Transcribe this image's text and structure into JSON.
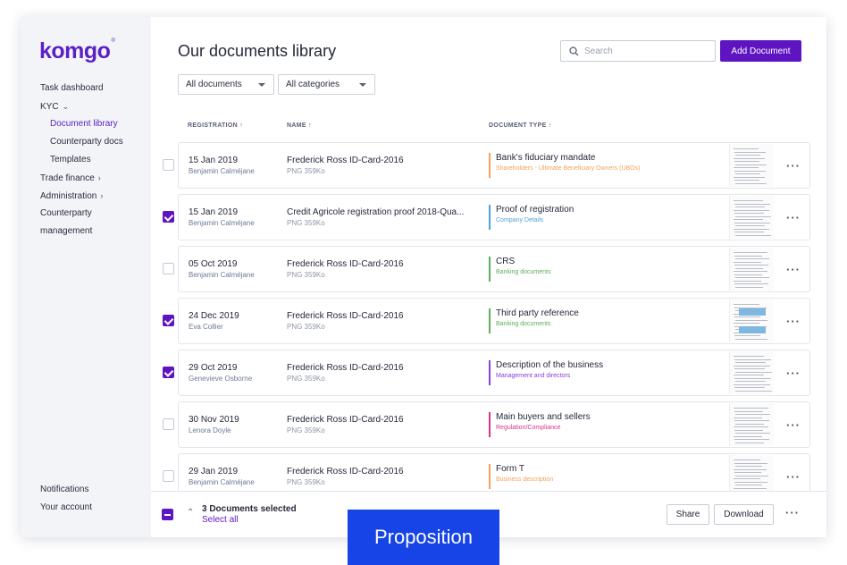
{
  "app": {
    "logo": "komgo",
    "logo_mark": "®"
  },
  "sidebar": {
    "items": [
      {
        "label": "Task dashboard"
      },
      {
        "label": "KYC",
        "chevron": "⌄"
      },
      {
        "label": "Document library",
        "active": true
      },
      {
        "label": "Counterparty docs"
      },
      {
        "label": "Templates"
      },
      {
        "label": "Trade finance",
        "chevron": "›"
      },
      {
        "label": "Administration",
        "chevron": "›"
      },
      {
        "label": "Counterparty"
      },
      {
        "label": "management"
      }
    ],
    "bottom": [
      {
        "label": "Notifications"
      },
      {
        "label": "Your account"
      }
    ]
  },
  "header": {
    "title": "Our documents library",
    "search_placeholder": "Search",
    "add_button": "Add Document"
  },
  "filters": {
    "documents": "All documents",
    "categories": "All categories"
  },
  "columns": {
    "registration": "REGISTRATION ↑",
    "name": "NAME ↑",
    "type": "DOCUMENT TYPE ↑"
  },
  "rows": [
    {
      "date": "15 Jan 2019",
      "person": "Benjamin Calméjane",
      "name": "Frederick Ross ID-Card-2016",
      "meta": "PNG   359Ko",
      "type": "Bank's fiduciary mandate",
      "category": "Shareholders - Ultimate Beneficiary Owners (UBOs)",
      "color": "#f2a35c",
      "checked": false
    },
    {
      "date": "15 Jan 2019",
      "person": "Benjamin Calméjane",
      "name": "Credit Agricole registration proof 2018-Qua...",
      "meta": "PNG   359Ko",
      "type": "Proof of registration",
      "category": "Company Details",
      "color": "#4fa3dc",
      "checked": true
    },
    {
      "date": "05 Oct 2019",
      "person": "Benjamin Calméjane",
      "name": "Frederick Ross ID-Card-2016",
      "meta": "PNG   359Ko",
      "type": "CRS",
      "category": "Banking documents",
      "color": "#5fae5a",
      "checked": false
    },
    {
      "date": "24 Dec 2019",
      "person": "Eva Collier",
      "name": "Frederick Ross ID-Card-2016",
      "meta": "PNG   359Ko",
      "type": "Third party reference",
      "category": "Banking documents",
      "color": "#5fae5a",
      "checked": true
    },
    {
      "date": "29 Oct 2019",
      "person": "Genevieve Osborne",
      "name": "Frederick Ross ID-Card-2016",
      "meta": "PNG   359Ko",
      "type": "Description of the business",
      "category": "Management and directors",
      "color": "#8a3fd8",
      "checked": true
    },
    {
      "date": "30 Nov 2019",
      "person": "Lenora Doyle",
      "name": "Frederick Ross ID-Card-2016",
      "meta": "PNG   359Ko",
      "type": "Main buyers and sellers",
      "category": "Regulation/Compliance",
      "color": "#d8338a",
      "checked": false
    },
    {
      "date": "29 Jan 2019",
      "person": "Benjamin Calméjane",
      "name": "Frederick Ross ID-Card-2016",
      "meta": "PNG   359Ko",
      "type": "Form T",
      "category": "Business description",
      "color": "#f2a35c",
      "checked": false
    }
  ],
  "footer": {
    "selected_count": "3 Documents selected",
    "select_all": "Select all",
    "share": "Share",
    "download": "Download"
  },
  "banner": "Proposition",
  "colors": {
    "accent": "#5e14c1",
    "banner": "#1644e6"
  }
}
